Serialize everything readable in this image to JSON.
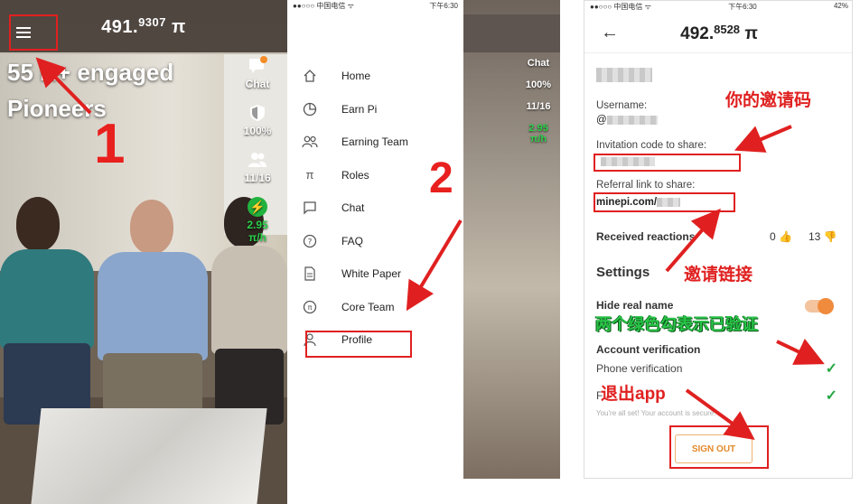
{
  "panel1": {
    "balance_main": "491.",
    "balance_decimal": "9307",
    "pi_symbol": "π",
    "headline_line1": "55 K+ engaged",
    "headline_line2": "Pioneers",
    "side": {
      "chat_label": "Chat",
      "security_value": "100%",
      "team_value": "11/16",
      "rate_value": "2.95",
      "rate_unit": "π/h"
    },
    "step_number": "1"
  },
  "panel2": {
    "status_carrier": "●●○○○ 中国电信 ᯤ",
    "status_time": "下午6:30",
    "status_battery": "42%",
    "menu_items": [
      {
        "label": "Home",
        "icon": "home-icon"
      },
      {
        "label": "Earn Pi",
        "icon": "pie-icon"
      },
      {
        "label": "Earning Team",
        "icon": "team-icon"
      },
      {
        "label": "Roles",
        "icon": "pi-icon"
      },
      {
        "label": "Chat",
        "icon": "chat-icon"
      },
      {
        "label": "FAQ",
        "icon": "faq-icon"
      },
      {
        "label": "White Paper",
        "icon": "document-icon"
      },
      {
        "label": "Core Team",
        "icon": "core-team-icon"
      },
      {
        "label": "Profile",
        "icon": "profile-icon"
      }
    ],
    "behind": {
      "chat_label": "Chat",
      "security_value": "100%",
      "team_value": "11/16",
      "rate_value": "2.95",
      "rate_unit": "π/h"
    },
    "step_number": "2"
  },
  "panel3": {
    "status_carrier": "●●○○○ 中国电信 ᯤ",
    "status_time": "下午6:30",
    "status_battery": "42%",
    "balance_main": "492.",
    "balance_decimal": "8528",
    "pi_symbol": "π",
    "username_label": "Username:",
    "username_prefix": "@",
    "invitation_label": "Invitation code to share:",
    "referral_label": "Referral link to share:",
    "referral_value": "minepi.com/",
    "reactions_label": "Received reactions",
    "reactions_up": "0",
    "reactions_down": "13",
    "settings_label": "Settings",
    "hide_name_label": "Hide real name",
    "account_verification_label": "Account verification",
    "phone_verification_label": "Phone verification",
    "all_set_note": "You're all set! Your account is secure.",
    "sign_out_label": "SIGN OUT",
    "annotations": {
      "invite_code_cn": "你的邀请码",
      "referral_link_cn": "邀请链接",
      "verified_cn": "两个绿色勾表示已验证",
      "sign_out_cn": "退出app"
    }
  },
  "colors": {
    "annotation_red": "#e02020",
    "verified_green": "#27a844",
    "toggle_orange": "#f08a3c",
    "signout_orange": "#e48a2a"
  }
}
